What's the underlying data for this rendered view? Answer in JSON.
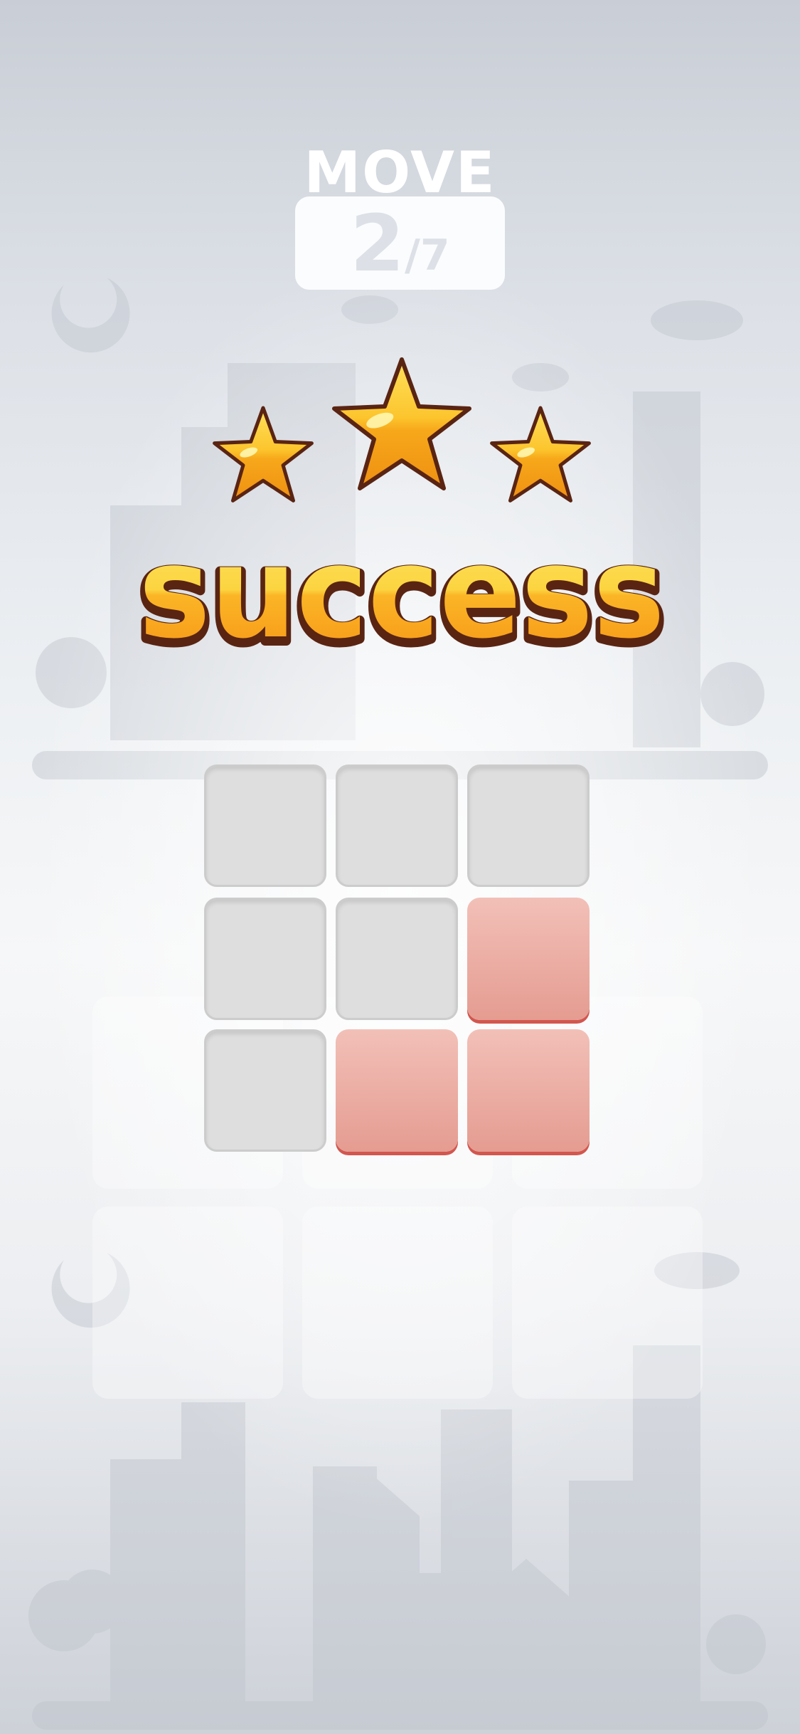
{
  "game": {
    "move_label": "MOVE",
    "move_current": "2",
    "move_separator": "/",
    "move_total": "7",
    "rating_stars": 3,
    "rating_max": 3,
    "result_text": "success"
  },
  "board": {
    "rows": 3,
    "cols": 3,
    "cells": [
      [
        0,
        0,
        0
      ],
      [
        0,
        0,
        1
      ],
      [
        0,
        1,
        1
      ]
    ],
    "filled_color": "#e9a79d",
    "filled_edge_color": "#d2574f",
    "empty_color": "#dedede"
  },
  "colors": {
    "star_gold": "#f7a81a",
    "star_highlight": "#ffe36a",
    "outline": "#5a2412",
    "banner_yellow": "#fcd440",
    "banner_orange": "#f9a21a"
  }
}
